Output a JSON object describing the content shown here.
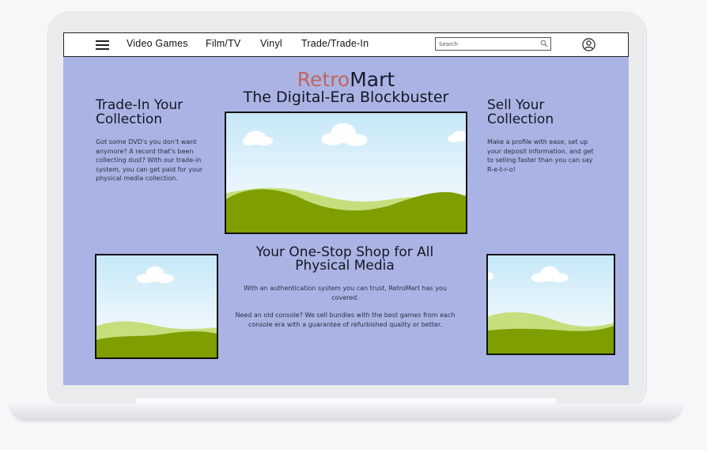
{
  "nav": {
    "menu_icon": "hamburger-menu-icon",
    "links": [
      "Video Games",
      "Film/TV",
      "Vinyl",
      "Trade/Trade-In"
    ],
    "search_placeholder": "Search",
    "search_icon": "search-icon",
    "account_icon": "user-account-icon"
  },
  "hero": {
    "brand_part1": "Retro",
    "brand_part2": "Mart",
    "tagline": "The Digital-Era Blockbuster"
  },
  "left_column": {
    "heading_line1": "Trade-In Your",
    "heading_line2": "Collection",
    "body_lines": [
      "Got some DVD's you don't want",
      "anymore? A record that's been",
      "collecting dust? With our trade-in",
      "system, you can get paid for your",
      "physical media collection."
    ]
  },
  "right_column": {
    "heading_line1": "Sell Your",
    "heading_line2": "Collection",
    "body_lines": [
      "Make a profile with ease, set up",
      "your deposit information, and get",
      "to selling faster than you can say",
      "R-e-t-r-o!"
    ]
  },
  "center": {
    "heading_line1": "Your One-Stop Shop for All",
    "heading_line2": "Physical Media",
    "paragraph1_lines": [
      "With an authentication system you can trust, RetroMart has you",
      "covered."
    ],
    "paragraph2_lines": [
      "Need an old console? We sell bundles with the best games from each",
      "console era with a guarantee of refurbished quality or better."
    ]
  },
  "colors": {
    "screen_bg": "#aab4e4",
    "brand_accent": "#c0655c",
    "hill_dark": "#7f9e00",
    "hill_light": "#c4df7c"
  }
}
